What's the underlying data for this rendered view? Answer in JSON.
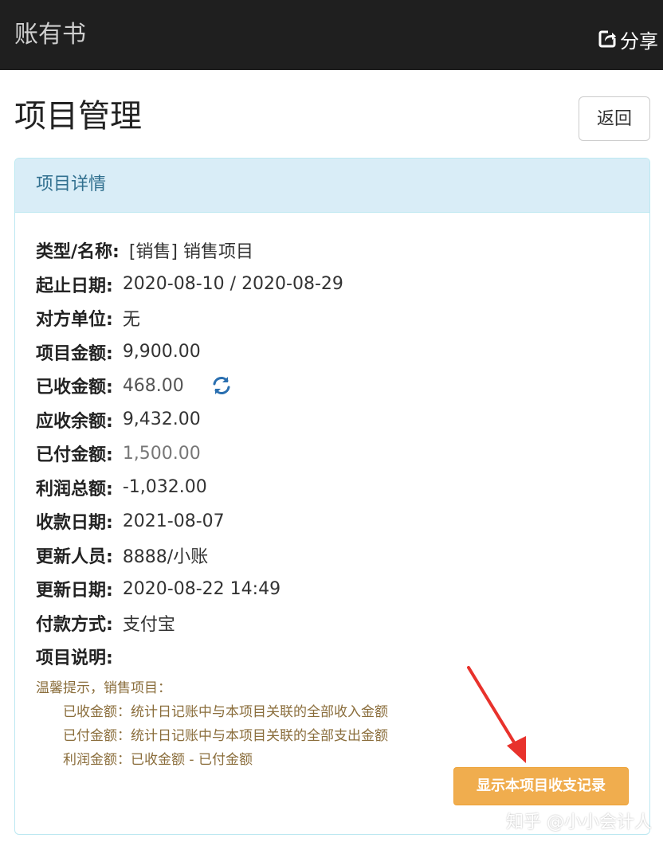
{
  "header": {
    "app_title": "账有书",
    "share_label": "分享"
  },
  "page": {
    "title": "项目管理",
    "back_label": "返回"
  },
  "panel": {
    "heading": "项目详情",
    "rows": [
      {
        "label": "类型/名称:",
        "value": "[销售] 销售项目"
      },
      {
        "label": "起止日期:",
        "value": "2020-08-10 / 2020-08-29"
      },
      {
        "label": "对方单位:",
        "value": "无"
      },
      {
        "label": "项目金额:",
        "value": "9,900.00"
      },
      {
        "label": "已收金额:",
        "value": "468.00"
      },
      {
        "label": "应收余额:",
        "value": "9,432.00"
      },
      {
        "label": "已付金额:",
        "value": "1,500.00"
      },
      {
        "label": "利润总额:",
        "value": "-1,032.00"
      },
      {
        "label": "收款日期:",
        "value": "2021-08-07"
      },
      {
        "label": "更新人员:",
        "value": "8888/小账"
      },
      {
        "label": "更新日期:",
        "value": "2020-08-22 14:49"
      },
      {
        "label": "付款方式:",
        "value": "支付宝"
      },
      {
        "label": "项目说明:",
        "value": ""
      }
    ],
    "tips": {
      "heading": "温馨提示，销售项目：",
      "lines": [
        "已收金额：统计日记账中与本项目关联的全部收入金额",
        "已付金额：统计日记账中与本项目关联的全部支出金额",
        "利润金额：已收金额 - 已付金额"
      ]
    },
    "records_button": "显示本项目收支记录"
  },
  "watermark": "知乎 @小小会计人",
  "icons": {
    "share": "share-icon",
    "refresh": "refresh-icon"
  },
  "colors": {
    "topbar": "#1f1f1f",
    "panel_header": "#d9edf7",
    "panel_header_text": "#31708f",
    "refresh_icon": "#2a6fb0",
    "tips_text": "#8a6d3b",
    "records_button": "#f0ad4e",
    "arrow": "#e8322c"
  }
}
